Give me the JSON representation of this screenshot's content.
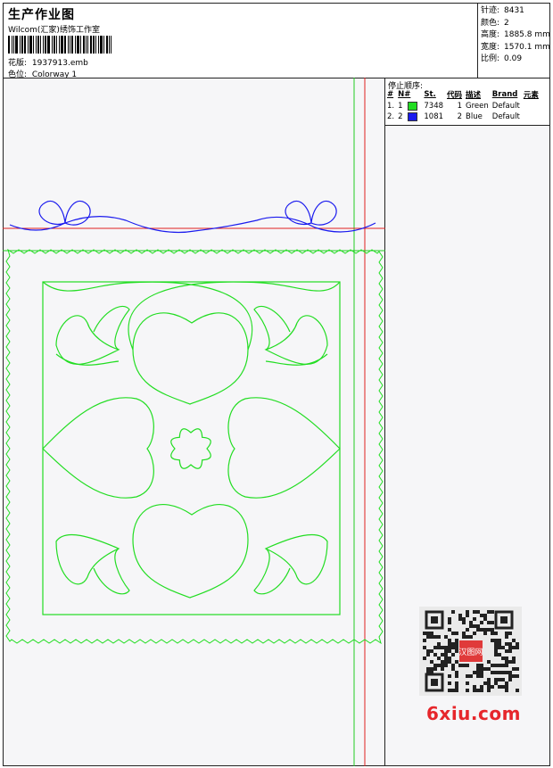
{
  "header": {
    "title": "生产作业图",
    "subtitle": "Wilcom(汇家)绣饰工作室",
    "design_label": "花版:",
    "design_value": "1937913.emb",
    "colorway_label": "色位:",
    "colorway_value": "Colorway 1"
  },
  "stats": [
    {
      "label": "针迹:",
      "value": "8431"
    },
    {
      "label": "颜色:",
      "value": "2"
    },
    {
      "label": "高度:",
      "value": "1885.8 mm"
    },
    {
      "label": "宽度:",
      "value": "1570.1 mm"
    },
    {
      "label": "比例:",
      "value": "0.09"
    }
  ],
  "stop_sequence": {
    "title": "停止顺序:",
    "columns": [
      "#",
      "N#",
      "St.",
      "代码",
      "描述",
      "Brand",
      "元素"
    ],
    "rows": [
      {
        "idx": "1.",
        "n": "1",
        "color": "#22dd22",
        "stitches": "7348",
        "code": "1",
        "desc": "Green",
        "brand": "Default"
      },
      {
        "idx": "2.",
        "n": "2",
        "color": "#1a1aee",
        "stitches": "1081",
        "code": "2",
        "desc": "Blue",
        "brand": "Default"
      }
    ]
  },
  "colors": {
    "green": "#22dd22",
    "blue": "#1a1aee",
    "red_guide": "#e02020",
    "green_guide": "#22cc22"
  },
  "watermark": {
    "badge": "汉图网",
    "site": "6xiu.com"
  }
}
